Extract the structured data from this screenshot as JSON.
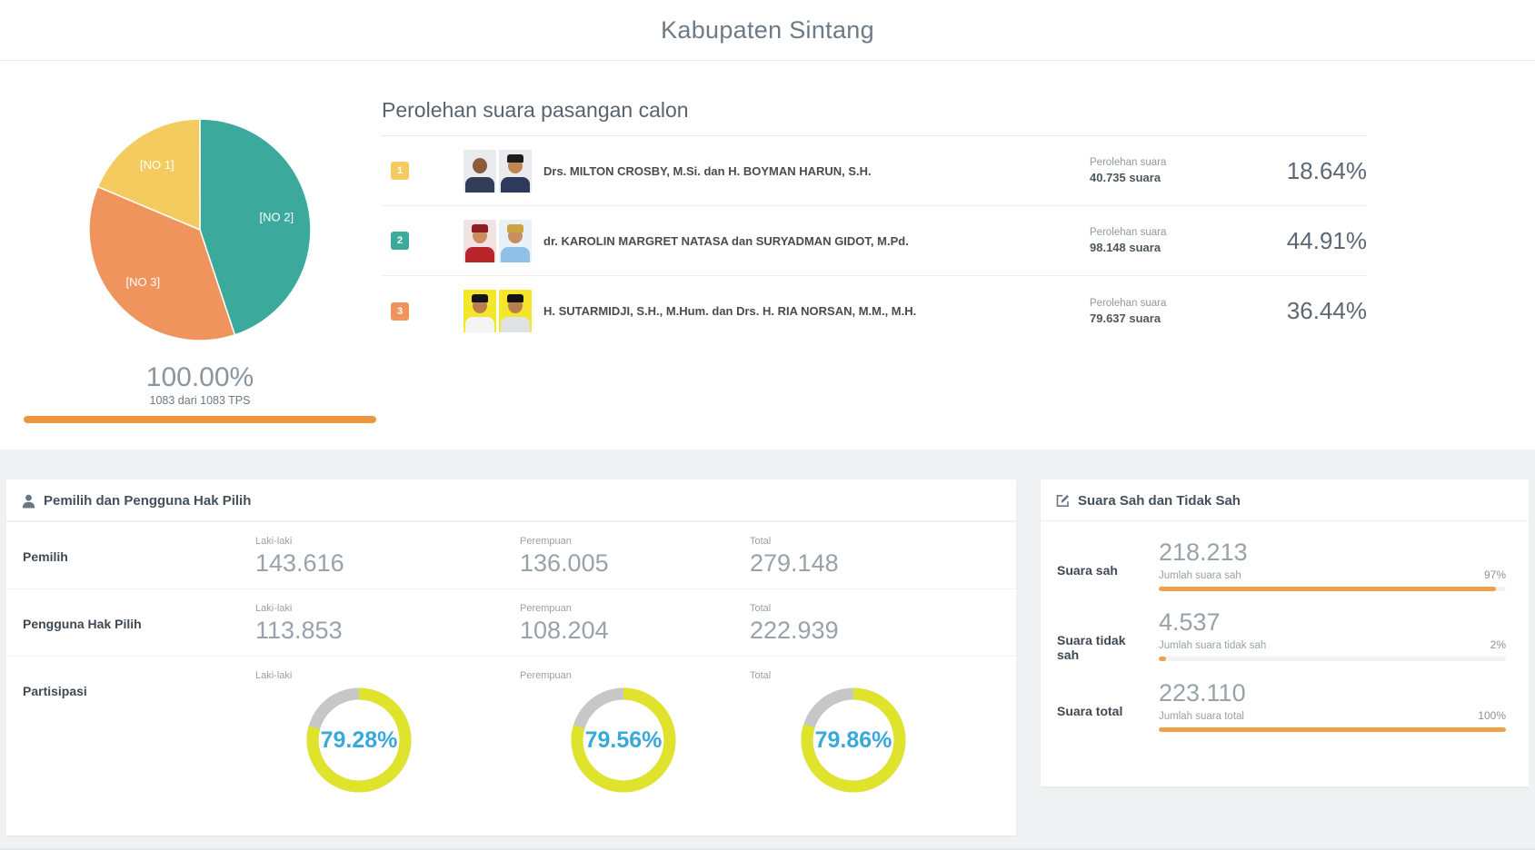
{
  "header": {
    "title": "Kabupaten Sintang"
  },
  "summary": {
    "percent": "100.00%",
    "tps": "1083 dari 1083 TPS",
    "bar_percent": 100,
    "bar_color": "#f0953f"
  },
  "results": {
    "title": "Perolehan suara pasangan calon",
    "vote_label": "Perolehan suara",
    "candidates": [
      {
        "no": "1",
        "name": "Drs. MILTON CROSBY, M.Si. dan H. BOYMAN HARUN, S.H.",
        "votes": "40.735 suara",
        "percent": "18.64%",
        "color": "#f3cb5e",
        "photos": [
          {
            "bg": "#e9ebee",
            "body": "#323d57",
            "cap": "",
            "skin": "#8d5a3b"
          },
          {
            "bg": "#e9ebee",
            "body": "#2d3a5e",
            "cap": "#1d1d1d",
            "skin": "#c08552"
          }
        ]
      },
      {
        "no": "2",
        "name": "dr. KAROLIN MARGRET NATASA dan SURYADMAN GIDOT, M.Pd.",
        "votes": "98.148 suara",
        "percent": "44.91%",
        "color": "#3baa9d",
        "photos": [
          {
            "bg": "#f2e3e3",
            "body": "#b8262c",
            "cap": "#8f1f24",
            "skin": "#c98e5f"
          },
          {
            "bg": "#e8f1f8",
            "body": "#8fc0e8",
            "cap": "#caa43e",
            "skin": "#c98e5f"
          }
        ]
      },
      {
        "no": "3",
        "name": "H. SUTARMIDJI, S.H., M.Hum. dan Drs. H. RIA NORSAN, M.M., M.H.",
        "votes": "79.637 suara",
        "percent": "36.44%",
        "color": "#f0945e",
        "photos": [
          {
            "bg": "#f6e62b",
            "body": "#f4f4f4",
            "cap": "#141414",
            "skin": "#b97e4e"
          },
          {
            "bg": "#f6e62b",
            "body": "#dfe3e6",
            "cap": "#141414",
            "skin": "#b97e4e"
          }
        ]
      }
    ]
  },
  "voters_panel": {
    "title": "Pemilih dan Pengguna Hak Pilih",
    "col_labels": [
      "Laki-laki",
      "Perempuan",
      "Total"
    ],
    "rows": [
      {
        "label": "Pemilih",
        "values": [
          "143.616",
          "136.005",
          "279.148"
        ]
      },
      {
        "label": "Pengguna Hak Pilih",
        "values": [
          "113.853",
          "108.204",
          "222.939"
        ]
      }
    ],
    "participation": {
      "label": "Partisipasi",
      "values": [
        79.28,
        79.56,
        79.86
      ],
      "display": [
        "79.28%",
        "79.56%",
        "79.86%"
      ],
      "ring_color": "#dfe32b",
      "rest_color": "#c7c7c7",
      "text_color": "#38a9da"
    }
  },
  "votes_panel": {
    "title": "Suara Sah dan Tidak Sah",
    "rows": [
      {
        "label": "Suara sah",
        "value": "218.213",
        "sublabel": "Jumlah suara sah",
        "percent": 97,
        "percent_display": "97%"
      },
      {
        "label": "Suara tidak sah",
        "value": "4.537",
        "sublabel": "Jumlah suara tidak sah",
        "percent": 2,
        "percent_display": "2%"
      },
      {
        "label": "Suara total",
        "value": "223.110",
        "sublabel": "Jumlah suara total",
        "percent": 100,
        "percent_display": "100%"
      }
    ],
    "bar_color": "#eca24d"
  },
  "chart_data": [
    {
      "type": "pie",
      "title": "Perolehan suara pasangan calon",
      "slices": [
        {
          "label": "[NO 2]",
          "value": 44.91,
          "color": "#3baa9d"
        },
        {
          "label": "[NO 3]",
          "value": 36.44,
          "color": "#f0945e"
        },
        {
          "label": "[NO 1]",
          "value": 18.64,
          "color": "#f3cb5e"
        }
      ],
      "start_angle_deg_from_top": 0,
      "direction": "clockwise",
      "labels_inside": true,
      "label_color": "#ffffff"
    },
    {
      "type": "donut",
      "title": "Partisipasi",
      "categories": [
        "Laki-laki",
        "Perempuan",
        "Total"
      ],
      "values": [
        79.28,
        79.56,
        79.86
      ],
      "value_max": 100
    },
    {
      "type": "bar",
      "title": "Suara Sah dan Tidak Sah",
      "categories": [
        "Suara sah",
        "Suara tidak sah",
        "Suara total"
      ],
      "values": [
        97,
        2,
        100
      ],
      "value_max": 100
    },
    {
      "type": "bar",
      "title": "TPS terhitung",
      "categories": [
        "TPS"
      ],
      "values": [
        100
      ],
      "value_max": 100,
      "annotation": "1083 dari 1083 TPS"
    }
  ]
}
